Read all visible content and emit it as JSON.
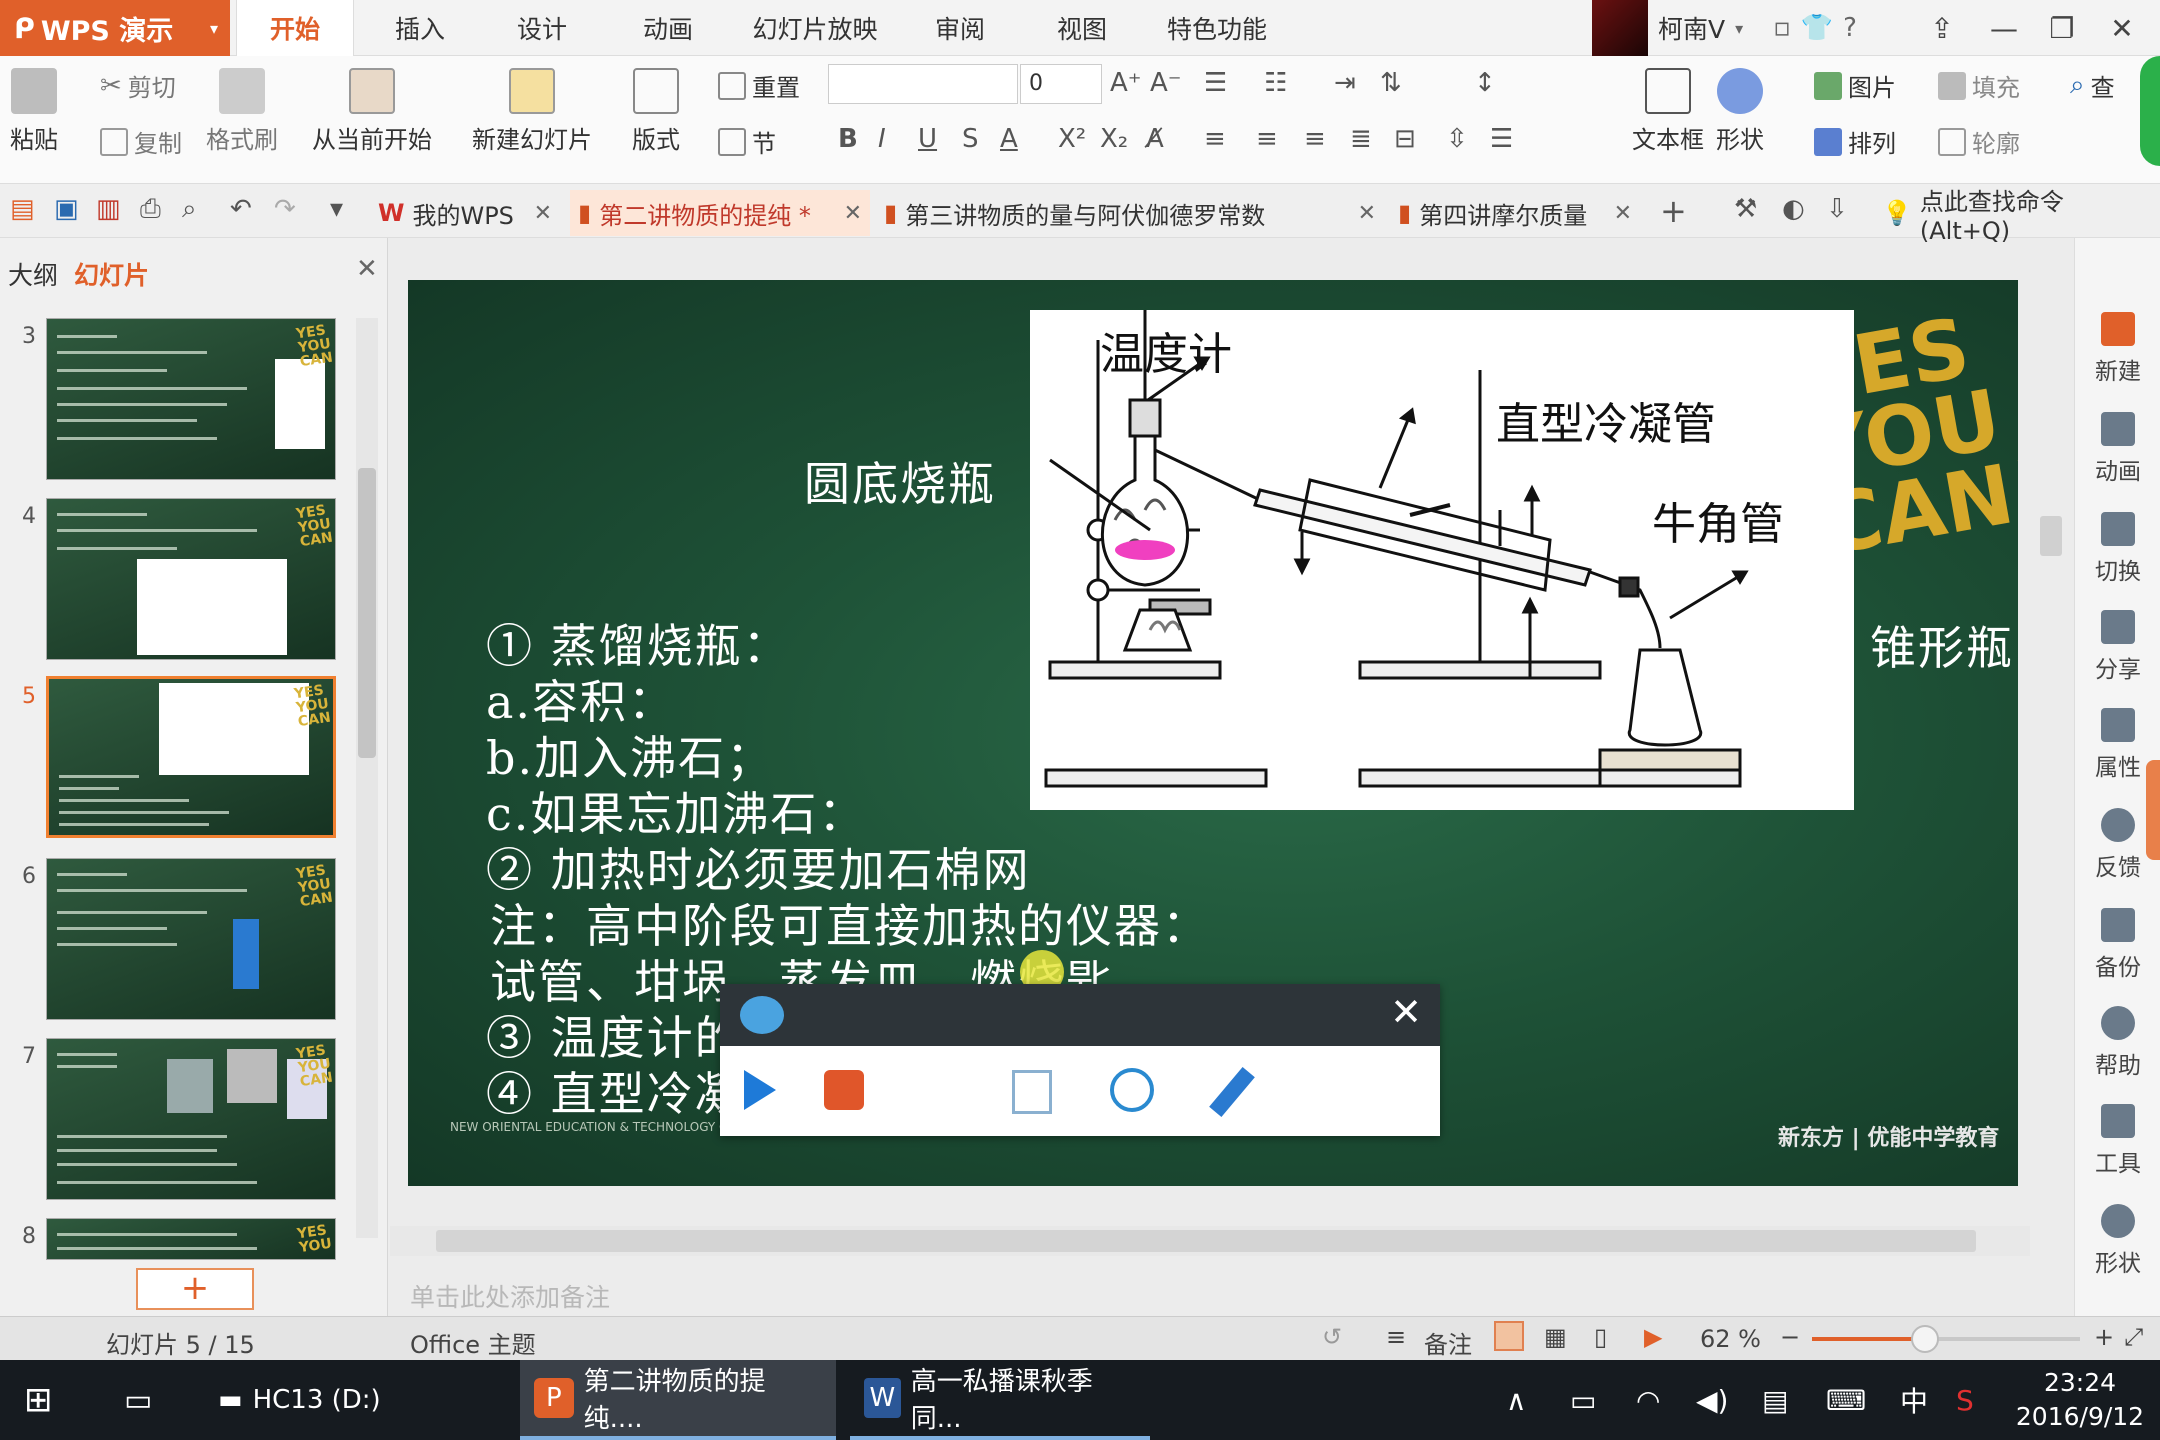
{
  "app": {
    "title": "WPS 演示"
  },
  "menu_tabs": [
    "开始",
    "插入",
    "设计",
    "动画",
    "幻灯片放映",
    "审阅",
    "视图",
    "特色功能"
  ],
  "user": {
    "name": "柯南V"
  },
  "ribbon": {
    "paste": "粘贴",
    "cut": "剪切",
    "copy": "复制",
    "format_painter": "格式刷",
    "from_current": "从当前开始",
    "new_slide": "新建幻灯片",
    "layout": "版式",
    "reset": "重置",
    "section": "节",
    "font_name": "",
    "font_size": "0",
    "textbox": "文本框",
    "shape": "形状",
    "picture": "图片",
    "fill": "填充",
    "arrange": "排列",
    "outline": "轮廓",
    "find": "查"
  },
  "quick_tabs": {
    "mywps": "我的WPS",
    "doc1": "第二讲物质的提纯 *",
    "doc2": "第三讲物质的量与阿伏伽德罗常数",
    "doc3": "第四讲摩尔质量",
    "find_cmd": "点此查找命令 (Alt+Q)"
  },
  "panel": {
    "tab_outline": "大纲",
    "tab_slides": "幻灯片",
    "thumb_numbers": [
      "3",
      "4",
      "5",
      "6",
      "7",
      "8"
    ],
    "yes": "YES YOU CAN!"
  },
  "slide": {
    "yes_text": "YES YOU CAN!",
    "labels": {
      "thermometer": "温度计",
      "condenser": "直型冷凝管",
      "flask": "圆底烧瓶",
      "adapter": "牛角管",
      "conical": "锥形瓶"
    },
    "lines": [
      "① 蒸馏烧瓶：",
      "a.容积：",
      "b.加入沸石；",
      "c.如果忘加沸石：",
      "② 加热时必须要加石棉网",
      "注：高中阶段可直接加热的仪器：",
      "试管、坩埚、蒸发皿、燃烧匙",
      "③ 温度计的",
      "④ 直型冷凝"
    ],
    "logo": "新东方 | 优能中学教育",
    "footer": "NEW ORIENTAL EDUCATION & TECHNOLOGY GROUP"
  },
  "notes_placeholder": "单击此处添加备注",
  "right_panel": [
    "新建",
    "动画",
    "切换",
    "分享",
    "属性",
    "反馈",
    "备份",
    "帮助",
    "工具",
    "形状"
  ],
  "status": {
    "slide_counter": "幻灯片 5 / 15",
    "theme": "Office 主题",
    "notes": "备注",
    "zoom": "62 %",
    "zoom_level": 0.42
  },
  "taskbar": {
    "drive": "HC13 (D:)",
    "wps_task": "第二讲物质的提纯....",
    "word_task": "高一私播课秋季同...",
    "ime": "中",
    "time": "23:24",
    "date": "2016/9/12"
  },
  "colors": {
    "accent": "#e0602a",
    "slide_bg": "#1e5237"
  }
}
